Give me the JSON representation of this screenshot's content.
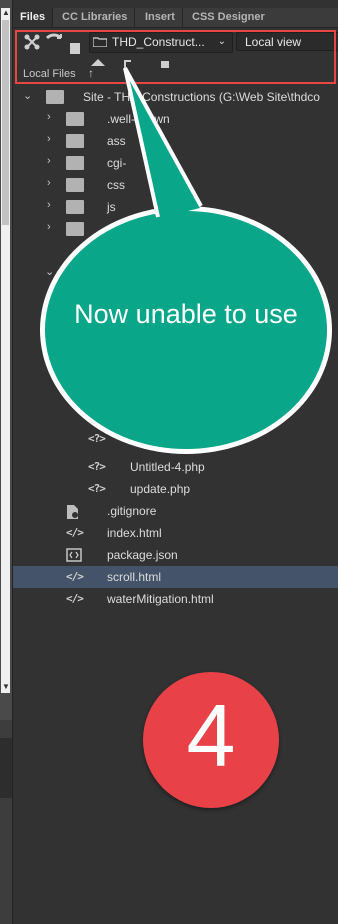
{
  "tabs": [
    "Files",
    "CC Libraries",
    "Insert",
    "CSS Designer"
  ],
  "toolbar": {
    "site_select": "THD_Construct...",
    "view_select": "Local view"
  },
  "subbar": {
    "label": "Local Files",
    "up_arrow": "↑"
  },
  "tree": {
    "site": "Site - THD Constructions (G:\\Web Site\\thdco",
    "folders": [
      ".well-known",
      "ass",
      "cgi-",
      "css",
      "js"
    ],
    "nested_files": [
      "Untitled-4.php",
      "update.php"
    ],
    "root_files": [
      ".gitignore",
      "index.html",
      "package.json",
      "scroll.html",
      "waterMitigation.html"
    ],
    "selected": "scroll.html"
  },
  "callout": {
    "text": "Now unable to use",
    "color": "#0aa68a"
  },
  "step_badge": {
    "number": "4",
    "color": "#e84148"
  },
  "colors": {
    "highlight_border": "#e94545",
    "selected_row": "#44536a",
    "panel_bg": "#323232"
  }
}
